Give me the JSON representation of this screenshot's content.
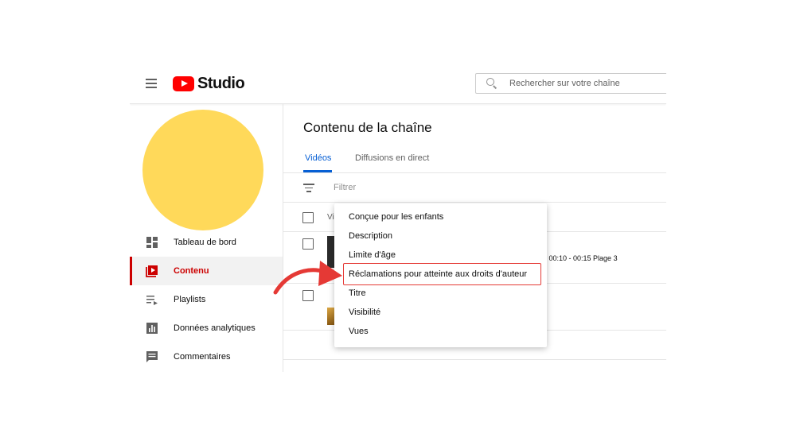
{
  "header": {
    "logo_text": "Studio",
    "search_placeholder": "Rechercher sur votre chaîne"
  },
  "sidebar": {
    "items": [
      {
        "label": "Tableau de bord",
        "icon": "dashboard-icon",
        "active": false
      },
      {
        "label": "Contenu",
        "icon": "content-icon",
        "active": true
      },
      {
        "label": "Playlists",
        "icon": "playlist-icon",
        "active": false
      },
      {
        "label": "Données analytiques",
        "icon": "analytics-icon",
        "active": false
      },
      {
        "label": "Commentaires",
        "icon": "comments-icon",
        "active": false
      }
    ]
  },
  "main": {
    "title": "Contenu de la chaîne",
    "tabs": [
      {
        "label": "Vidéos",
        "active": true
      },
      {
        "label": "Diffusions en direct",
        "active": false
      }
    ],
    "filter_label": "Filtrer",
    "table_header_partial": "Vi",
    "row1_text_partial": "2 00:10 - 00:15 Plage 3"
  },
  "filter_menu": {
    "items": [
      "Conçue pour les enfants",
      "Description",
      "Limite d'âge",
      "Réclamations pour atteinte aux droits d'auteur",
      "Titre",
      "Visibilité",
      "Vues"
    ],
    "highlighted_index": 3
  },
  "colors": {
    "accent_blue": "#065fd4",
    "accent_red": "#cc0000",
    "avatar": "#ffd95a",
    "annotation_red": "#e53935"
  }
}
